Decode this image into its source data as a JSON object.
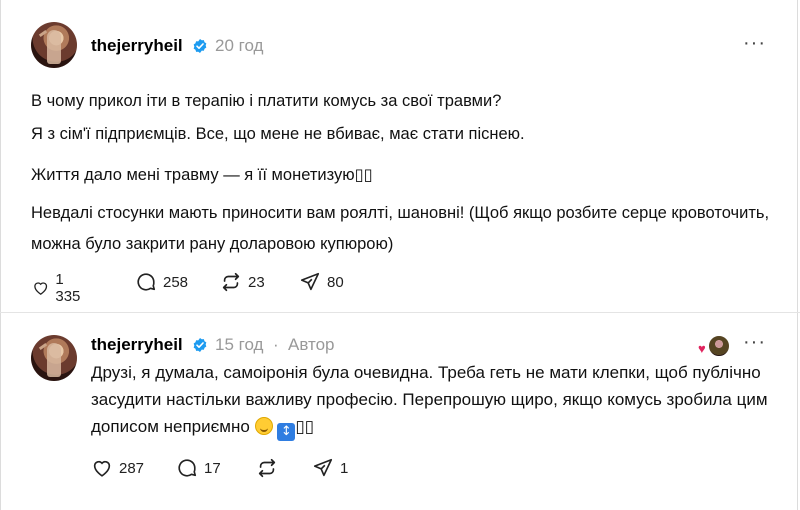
{
  "posts": [
    {
      "username": "thejerryheil",
      "time": "20 год",
      "author_tag": "",
      "paragraphs": [
        "В чому прикол іти в терапію і платити комусь за свої травми?",
        "Я з сім'ї підприємців. Все, що мене не вбиває, має стати піснею.",
        "Життя дало мені травму — я її монетизую▯▯",
        "Невдалі стосунки мають приносити вам роялті, шановні! (Щоб якщо розбите серце кровоточить, можна було закрити рану доларовою купюрою)"
      ],
      "stats": {
        "likes": "1 335",
        "replies": "258",
        "reposts": "23",
        "shares": "80"
      }
    },
    {
      "username": "thejerryheil",
      "time": "15 год",
      "separator": "·",
      "author_tag": "Автор",
      "body": "Друзі, я думала, самоіронія була очевидна. Треба геть не мати клепки, щоб публічно засудити настільки важливу професію. Перепрошую щиро, якщо комусь зробила цим дописом неприємно",
      "emoji_tail": "▯▯",
      "stats": {
        "likes": "287",
        "replies": "17",
        "reposts": "",
        "shares": "1"
      }
    }
  ],
  "icons": {
    "verified": "verified-badge-icon",
    "like": "heart-icon",
    "reply": "comment-icon",
    "repost": "repost-icon",
    "share": "send-icon",
    "more": "more-icon"
  },
  "colors": {
    "verified": "#1d9bf0",
    "muted": "#999999",
    "liker_heart": "#e0245e"
  }
}
